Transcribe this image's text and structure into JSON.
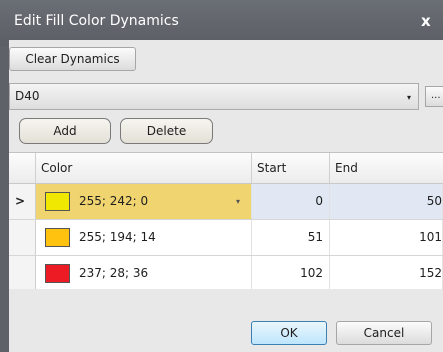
{
  "window": {
    "title": "Edit Fill Color Dynamics",
    "close_glyph": "x"
  },
  "toolbar": {
    "clear_label": "Clear Dynamics"
  },
  "selector": {
    "value": "D40",
    "arrow_glyph": "▾",
    "ellipsis_label": "..."
  },
  "actions": {
    "add_label": "Add",
    "delete_label": "Delete"
  },
  "grid": {
    "columns": {
      "color": "Color",
      "start": "Start",
      "end": "End"
    },
    "current_row_glyph": ">",
    "dropdown_glyph": "▾",
    "rows": [
      {
        "swatch": "#f0e800",
        "color": "255; 242; 0",
        "start": "0",
        "end": "50"
      },
      {
        "swatch": "#ffc20e",
        "color": "255; 194; 14",
        "start": "51",
        "end": "101"
      },
      {
        "swatch": "#ed1c24",
        "color": "237; 28; 36",
        "start": "102",
        "end": "152"
      }
    ]
  },
  "footer": {
    "ok_label": "OK",
    "cancel_label": "Cancel"
  }
}
